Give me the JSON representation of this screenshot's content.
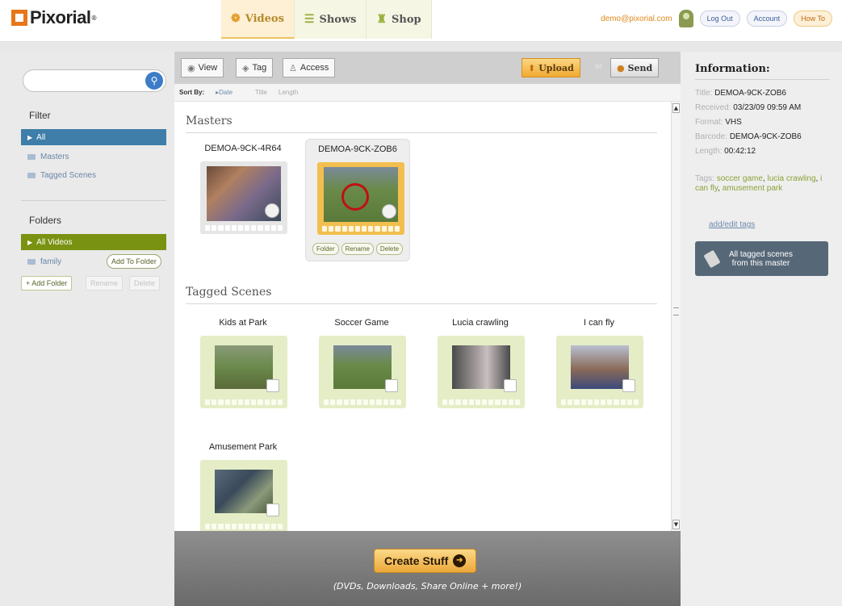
{
  "brand": {
    "name": "Pixorial",
    "reg": "®"
  },
  "nav": {
    "tabs": [
      {
        "label": "Videos",
        "icon": "film-reel-icon",
        "active": true
      },
      {
        "label": "Shows",
        "icon": "slides-icon",
        "active": false
      },
      {
        "label": "Shop",
        "icon": "cart-icon",
        "active": false
      }
    ],
    "user_email": "demo@pixorial.com",
    "avatar_label": "pro",
    "logout": "Log Out",
    "account": "Account",
    "howto": "How To"
  },
  "sidebar": {
    "search_placeholder": "",
    "filter_heading": "Filter",
    "filters": [
      "All",
      "Masters",
      "Tagged Scenes"
    ],
    "folders_heading": "Folders",
    "folders": [
      "All Videos",
      "family"
    ],
    "add_to_folder": "Add To Folder",
    "add_folder": "+ Add Folder",
    "rename": "Rename",
    "delete": "Delete"
  },
  "toolbar": {
    "view": "View",
    "tag": "Tag",
    "access": "Access",
    "upload": "Upload",
    "or": "or",
    "send": "Send"
  },
  "sort": {
    "label": "Sort By:",
    "options": [
      "Date",
      "Title",
      "Length"
    ],
    "current": "Date"
  },
  "masters": {
    "heading": "Masters",
    "items": [
      {
        "title": "DEMOA-9CK-4R64"
      },
      {
        "title": "DEMOA-9CK-ZOB6"
      }
    ],
    "actions": [
      "Folder",
      "Rename",
      "Delete"
    ]
  },
  "scenes": {
    "heading": "Tagged Scenes",
    "items": [
      {
        "title": "Kids at Park"
      },
      {
        "title": "Soccer Game"
      },
      {
        "title": "Lucia crawling"
      },
      {
        "title": "I can fly"
      },
      {
        "title": "Amusement Park"
      }
    ]
  },
  "footer": {
    "create": "Create Stuff",
    "subtitle": "(DVDs, Downloads, Share Online + more!)"
  },
  "info": {
    "heading": "Information:",
    "title_label": "Title:",
    "title": "DEMOA-9CK-ZOB6",
    "received_label": "Received:",
    "received": "03/23/09 09:59 AM",
    "format_label": "Format:",
    "format": "VHS",
    "barcode_label": "Barcode:",
    "barcode": "DEMOA-9CK-ZOB6",
    "length_label": "Length:",
    "length": "00:42:12",
    "tags_label": "Tags:",
    "tags": [
      "soccer game",
      "lucia crawling",
      "i can fly",
      "amusement park"
    ],
    "add_edit_tags": "add/edit tags",
    "tagged_button_line1": "All tagged scenes",
    "tagged_button_line2": "from this master"
  }
}
